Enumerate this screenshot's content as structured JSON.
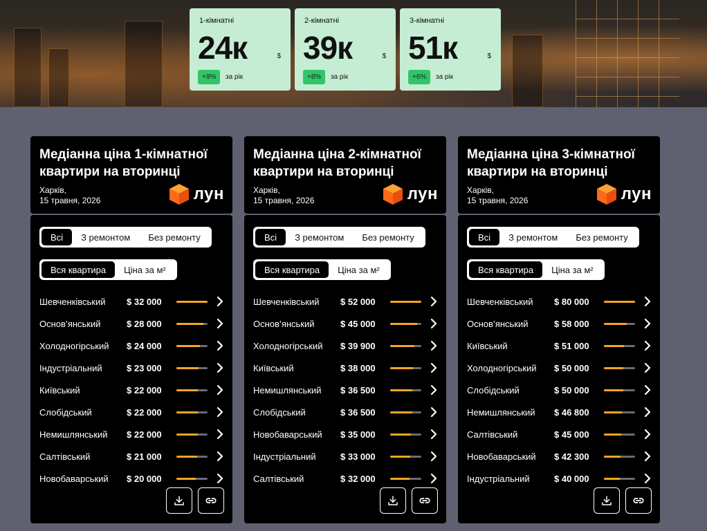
{
  "stats": [
    {
      "label": "1-кімнатні",
      "value": "24к",
      "currency": "$",
      "change": "+9%",
      "period": "за рік"
    },
    {
      "label": "2-кімнатні",
      "value": "39к",
      "currency": "$",
      "change": "+8%",
      "period": "за рік"
    },
    {
      "label": "3-кімнатні",
      "value": "51к",
      "currency": "$",
      "change": "+6%",
      "period": "за рік"
    }
  ],
  "colors": {
    "accent": "#f5a623",
    "stat_bg": "#c5edd4",
    "badge": "#33c46a",
    "page_bg": "#5f6171"
  },
  "cards": [
    {
      "title": "Медіанна ціна 1-кімнатної квартири на вторинці",
      "city": "Харків,",
      "date": "15 травня, 2026",
      "logo": "лун",
      "filters1": [
        "Всі",
        "З ремонтом",
        "Без ремонту"
      ],
      "filters2": [
        "Вся квартира",
        "Ціна за м²"
      ],
      "rows": [
        {
          "name": "Шевченківський",
          "price": "$ 32 000",
          "ratio": 1.0
        },
        {
          "name": "Основ’янський",
          "price": "$ 28 000",
          "ratio": 0.875
        },
        {
          "name": "Холодногірський",
          "price": "$ 24 000",
          "ratio": 0.75
        },
        {
          "name": "Індустріальний",
          "price": "$ 23 000",
          "ratio": 0.72
        },
        {
          "name": "Київський",
          "price": "$ 22 000",
          "ratio": 0.69
        },
        {
          "name": "Слобідський",
          "price": "$ 22 000",
          "ratio": 0.69
        },
        {
          "name": "Немишлянський",
          "price": "$ 22 000",
          "ratio": 0.69
        },
        {
          "name": "Салтівський",
          "price": "$ 21 000",
          "ratio": 0.66
        },
        {
          "name": "Новобаварський",
          "price": "$ 20 000",
          "ratio": 0.625
        }
      ]
    },
    {
      "title": "Медіанна ціна 2-кімнатної квартири на вторинці",
      "city": "Харків,",
      "date": "15 травня, 2026",
      "logo": "лун",
      "filters1": [
        "Всі",
        "З ремонтом",
        "Без ремонту"
      ],
      "filters2": [
        "Вся квартира",
        "Ціна за м²"
      ],
      "rows": [
        {
          "name": "Шевченківський",
          "price": "$ 52 000",
          "ratio": 1.0
        },
        {
          "name": "Основ’янський",
          "price": "$ 45 000",
          "ratio": 0.865
        },
        {
          "name": "Холодногірський",
          "price": "$ 39 900",
          "ratio": 0.767
        },
        {
          "name": "Київський",
          "price": "$ 38 000",
          "ratio": 0.73
        },
        {
          "name": "Немишлянський",
          "price": "$ 36 500",
          "ratio": 0.7
        },
        {
          "name": "Слобідський",
          "price": "$ 36 500",
          "ratio": 0.7
        },
        {
          "name": "Новобаварський",
          "price": "$ 35 000",
          "ratio": 0.673
        },
        {
          "name": "Індустріальний",
          "price": "$ 33 000",
          "ratio": 0.635
        },
        {
          "name": "Салтівський",
          "price": "$ 32 000",
          "ratio": 0.615
        }
      ]
    },
    {
      "title": "Медіанна ціна 3-кімнатної квартири на вторинці",
      "city": "Харків,",
      "date": "15 травня, 2026",
      "logo": "лун",
      "filters1": [
        "Всі",
        "З ремонтом",
        "Без ремонту"
      ],
      "filters2": [
        "Вся квартира",
        "Ціна за м²"
      ],
      "rows": [
        {
          "name": "Шевченківський",
          "price": "$ 80 000",
          "ratio": 1.0
        },
        {
          "name": "Основ’янський",
          "price": "$ 58 000",
          "ratio": 0.725
        },
        {
          "name": "Київський",
          "price": "$ 51 000",
          "ratio": 0.64
        },
        {
          "name": "Холодногірський",
          "price": "$ 50 000",
          "ratio": 0.625
        },
        {
          "name": "Слобідський",
          "price": "$ 50 000",
          "ratio": 0.625
        },
        {
          "name": "Немишлянський",
          "price": "$ 46 800",
          "ratio": 0.585
        },
        {
          "name": "Салтівський",
          "price": "$ 45 000",
          "ratio": 0.56
        },
        {
          "name": "Новобаварський",
          "price": "$ 42 300",
          "ratio": 0.53
        },
        {
          "name": "Індустріальний",
          "price": "$ 40 000",
          "ratio": 0.5
        }
      ]
    }
  ]
}
